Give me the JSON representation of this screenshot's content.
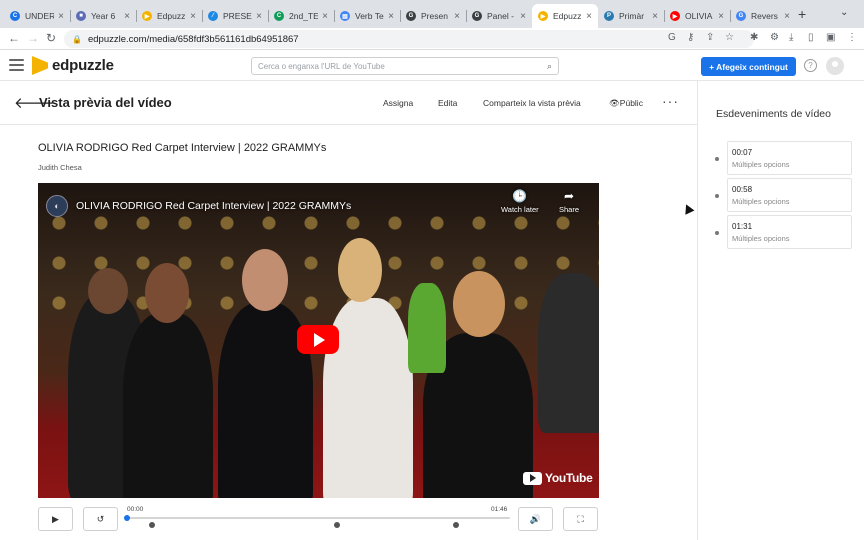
{
  "browser": {
    "tabs": [
      {
        "label": "UNDER",
        "favicon_color": "#1a73e8",
        "favicon_glyph": "C"
      },
      {
        "label": "Year 6",
        "favicon_color": "#5b6bb5",
        "favicon_glyph": "■"
      },
      {
        "label": "Edpuzz",
        "favicon_color": "#f5b301",
        "favicon_glyph": "▶"
      },
      {
        "label": "PRESE",
        "favicon_color": "#1e88e5",
        "favicon_glyph": "⁄"
      },
      {
        "label": "2nd_TE",
        "favicon_color": "#0f9d58",
        "favicon_glyph": "C"
      },
      {
        "label": "Verb Te",
        "favicon_color": "#4285f4",
        "favicon_glyph": "▤"
      },
      {
        "label": "Presen",
        "favicon_color": "#3c4043",
        "favicon_glyph": "G"
      },
      {
        "label": "Panel -",
        "favicon_color": "#3c4043",
        "favicon_glyph": "G"
      },
      {
        "label": "Edpuzz",
        "favicon_color": "#f5b301",
        "favicon_glyph": "▶",
        "active": true
      },
      {
        "label": "Primàr",
        "favicon_color": "#2a7ab0",
        "favicon_glyph": "P"
      },
      {
        "label": "OLIVIA",
        "favicon_color": "#ff0000",
        "favicon_glyph": "▶"
      },
      {
        "label": "Revers",
        "favicon_color": "#4285f4",
        "favicon_glyph": "G"
      }
    ],
    "url": "edpuzzle.com/media/658fdf3b561161db64951867"
  },
  "header": {
    "logo_text": "edpuzzle",
    "search_placeholder": "Cerca o enganxa l'URL de YouTube",
    "add_button": "+ Afegeix contingut",
    "help_glyph": "?"
  },
  "page": {
    "title": "Vista prèvia del vídeo",
    "actions": {
      "assign": "Assigna",
      "edit": "Edita",
      "share": "Comparteix la vista prèvia",
      "visibility": "Públic"
    },
    "more_glyph": "···"
  },
  "video": {
    "title": "OLIVIA RODRIGO Red Carpet Interview | 2022 GRAMMYs",
    "author": "Judith Chesa",
    "youtube_title": "OLIVIA RODRIGO Red Carpet Interview | 2022 GRAMMYs",
    "watch_later": "Watch later",
    "share": "Share",
    "youtube_logo": "YouTube",
    "current_time": "00:00",
    "duration": "01:46",
    "progress_fraction": 0.0,
    "question_markers_fraction": [
      0.066,
      0.547,
      0.858
    ]
  },
  "right_panel": {
    "title": "Esdeveniments de vídeo",
    "events": [
      {
        "time": "00:07",
        "kind": "Múltiples opcions"
      },
      {
        "time": "00:58",
        "kind": "Múltiples opcions"
      },
      {
        "time": "01:31",
        "kind": "Múltiples opcions"
      }
    ]
  },
  "colors": {
    "accent": "#1a73e8",
    "brand_yellow": "#f5b301",
    "youtube_red": "#ff0000"
  }
}
